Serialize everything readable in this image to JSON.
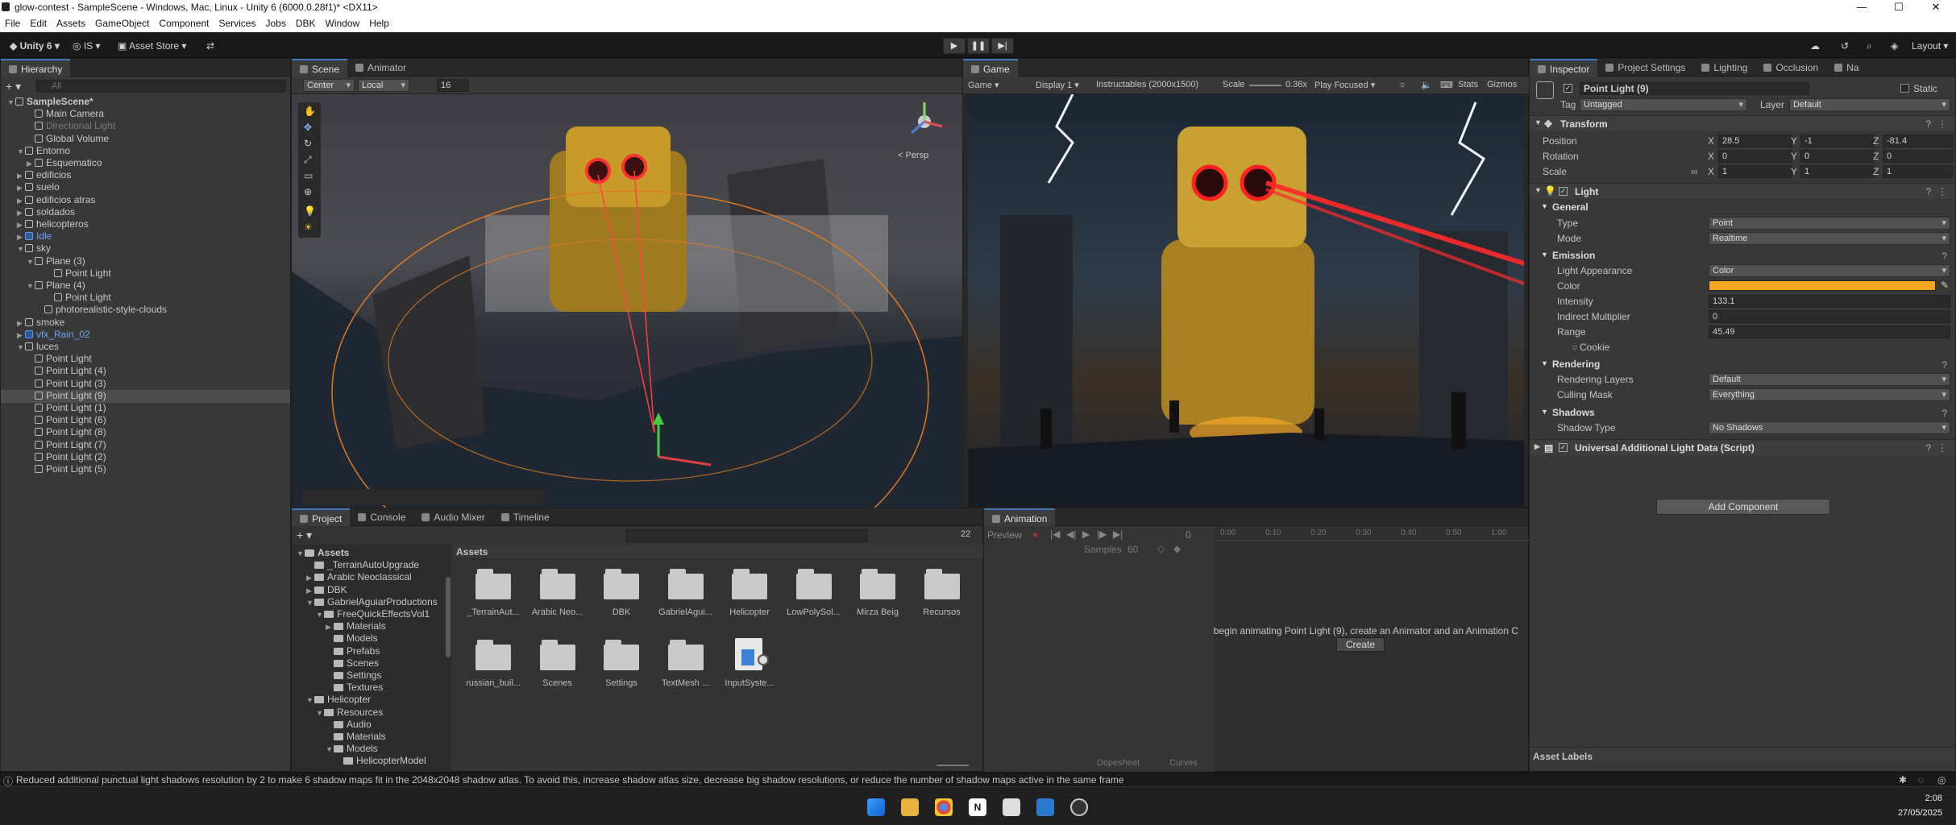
{
  "window": {
    "title": "glow-contest - SampleScene - Windows, Mac, Linux - Unity 6 (6000.0.28f1)* <DX11>",
    "minimize": "—",
    "maximize": "☐",
    "close": "✕"
  },
  "menu": [
    "File",
    "Edit",
    "Assets",
    "GameObject",
    "Component",
    "Services",
    "Jobs",
    "DBK",
    "Window",
    "Help"
  ],
  "toolbar": {
    "unity": "Unity 6",
    "account": "IS",
    "asset_store": "Asset Store",
    "layout": "Layout"
  },
  "hierarchy": {
    "tab": "Hierarchy",
    "search_placeholder": "All",
    "items": [
      {
        "label": "SampleScene*",
        "indent": 0,
        "arrow": "▼",
        "bold": true
      },
      {
        "label": "Main Camera",
        "indent": 2,
        "arrow": ""
      },
      {
        "label": "Directional Light",
        "indent": 2,
        "arrow": "",
        "dim": true
      },
      {
        "label": "Global Volume",
        "indent": 2,
        "arrow": ""
      },
      {
        "label": "Entorno",
        "indent": 1,
        "arrow": "▼"
      },
      {
        "label": "Esquematico",
        "indent": 2,
        "arrow": "▶"
      },
      {
        "label": "edificios",
        "indent": 1,
        "arrow": "▶"
      },
      {
        "label": "suelo",
        "indent": 1,
        "arrow": "▶"
      },
      {
        "label": "edificios atras",
        "indent": 1,
        "arrow": "▶"
      },
      {
        "label": "soldados",
        "indent": 1,
        "arrow": "▶"
      },
      {
        "label": "helicopteros",
        "indent": 1,
        "arrow": "▶"
      },
      {
        "label": "Idle",
        "indent": 1,
        "arrow": "▶",
        "blue": true
      },
      {
        "label": "sky",
        "indent": 1,
        "arrow": "▼"
      },
      {
        "label": "Plane (3)",
        "indent": 2,
        "arrow": "▼"
      },
      {
        "label": "Point Light",
        "indent": 4,
        "arrow": ""
      },
      {
        "label": "Plane (4)",
        "indent": 2,
        "arrow": "▼"
      },
      {
        "label": "Point Light",
        "indent": 4,
        "arrow": ""
      },
      {
        "label": "photorealistic-style-clouds",
        "indent": 3,
        "arrow": ""
      },
      {
        "label": "smoke",
        "indent": 1,
        "arrow": "▶"
      },
      {
        "label": "vfx_Rain_02",
        "indent": 1,
        "arrow": "▶",
        "blue": true
      },
      {
        "label": "luces",
        "indent": 1,
        "arrow": "▼"
      },
      {
        "label": "Point Light",
        "indent": 2,
        "arrow": ""
      },
      {
        "label": "Point Light (4)",
        "indent": 2,
        "arrow": ""
      },
      {
        "label": "Point Light (3)",
        "indent": 2,
        "arrow": ""
      },
      {
        "label": "Point Light (9)",
        "indent": 2,
        "arrow": "",
        "selected": true
      },
      {
        "label": "Point Light (1)",
        "indent": 2,
        "arrow": ""
      },
      {
        "label": "Point Light (6)",
        "indent": 2,
        "arrow": ""
      },
      {
        "label": "Point Light (8)",
        "indent": 2,
        "arrow": ""
      },
      {
        "label": "Point Light (7)",
        "indent": 2,
        "arrow": ""
      },
      {
        "label": "Point Light (2)",
        "indent": 2,
        "arrow": ""
      },
      {
        "label": "Point Light (5)",
        "indent": 2,
        "arrow": ""
      }
    ]
  },
  "scene": {
    "tabs": [
      "Scene",
      "Animator"
    ],
    "pivot": "Center",
    "space": "Local",
    "grid_size": "16",
    "persp": "< Persp"
  },
  "game": {
    "tab": "Game",
    "mode": "Game",
    "display": "Display 1",
    "resolution": "Instructables (2000x1500)",
    "scale_label": "Scale",
    "scale_value": "0.36x",
    "play_mode": "Play Focused",
    "stats": "Stats",
    "gizmos": "Gizmos"
  },
  "inspector": {
    "tabs": [
      "Inspector",
      "Project Settings",
      "Lighting",
      "Occlusion",
      "Na"
    ],
    "object_name": "Point Light (9)",
    "static": "Static",
    "tag_label": "Tag",
    "tag": "Untagged",
    "layer_label": "Layer",
    "layer": "Default",
    "transform": {
      "title": "Transform",
      "position_label": "Position",
      "rotation_label": "Rotation",
      "scale_label": "Scale",
      "position": {
        "x": "28.5",
        "y": "-1",
        "z": "-81.4"
      },
      "rotation": {
        "x": "0",
        "y": "0",
        "z": "0"
      },
      "scale": {
        "x": "1",
        "y": "1",
        "z": "1"
      }
    },
    "light": {
      "title": "Light",
      "general": "General",
      "type_label": "Type",
      "type": "Point",
      "mode_label": "Mode",
      "mode": "Realtime",
      "emission": "Emission",
      "appearance_label": "Light Appearance",
      "appearance": "Color",
      "color_label": "Color",
      "color": "#f5a623",
      "intensity_label": "Intensity",
      "intensity": "133.1",
      "indirect_label": "Indirect Multiplier",
      "indirect": "0",
      "range_label": "Range",
      "range": "45.49",
      "cookie_label": "Cookie",
      "rendering": "Rendering",
      "layers_label": "Rendering Layers",
      "layers": "Default",
      "culling_label": "Culling Mask",
      "culling": "Everything",
      "shadows": "Shadows",
      "shadow_type_label": "Shadow Type",
      "shadow_type": "No Shadows"
    },
    "ual": "Universal Additional Light Data (Script)",
    "add_component": "Add Component",
    "asset_labels": "Asset Labels"
  },
  "project": {
    "tabs": [
      "Project",
      "Console",
      "Audio Mixer",
      "Timeline"
    ],
    "count": "22",
    "breadcrumb": "Assets",
    "tree": [
      {
        "label": "Assets",
        "indent": 0,
        "arrow": "▼",
        "bold": true
      },
      {
        "label": "_TerrainAutoUpgrade",
        "indent": 1,
        "arrow": ""
      },
      {
        "label": "Arabic Neoclassical",
        "indent": 1,
        "arrow": "▶"
      },
      {
        "label": "DBK",
        "indent": 1,
        "arrow": "▶"
      },
      {
        "label": "GabrielAguiarProductions",
        "indent": 1,
        "arrow": "▼"
      },
      {
        "label": "FreeQuickEffectsVol1",
        "indent": 2,
        "arrow": "▼"
      },
      {
        "label": "Materials",
        "indent": 3,
        "arrow": "▶"
      },
      {
        "label": "Models",
        "indent": 3,
        "arrow": ""
      },
      {
        "label": "Prefabs",
        "indent": 3,
        "arrow": ""
      },
      {
        "label": "Scenes",
        "indent": 3,
        "arrow": ""
      },
      {
        "label": "Settings",
        "indent": 3,
        "arrow": ""
      },
      {
        "label": "Textures",
        "indent": 3,
        "arrow": ""
      },
      {
        "label": "Helicopter",
        "indent": 1,
        "arrow": "▼"
      },
      {
        "label": "Resources",
        "indent": 2,
        "arrow": "▼"
      },
      {
        "label": "Audio",
        "indent": 3,
        "arrow": ""
      },
      {
        "label": "Materials",
        "indent": 3,
        "arrow": ""
      },
      {
        "label": "Models",
        "indent": 3,
        "arrow": "▼"
      },
      {
        "label": "HelicopterModel",
        "indent": 4,
        "arrow": ""
      }
    ],
    "assets_row1": [
      "_TerrainAut...",
      "Arabic Neo...",
      "DBK",
      "GabrielAgui...",
      "Helicopter",
      "LowPolySol...",
      "Mirza Beig",
      "Recursos"
    ],
    "assets_row2": [
      "russian_buil...",
      "Scenes",
      "Settings",
      "TextMesh ...",
      "InputSyste..."
    ]
  },
  "animation": {
    "tab": "Animation",
    "preview": "Preview",
    "frame": "0",
    "samples_label": "Samples",
    "samples": "60",
    "ticks": [
      "0:00",
      "0:10",
      "0:20",
      "0:30",
      "0:40",
      "0:50",
      "1:00"
    ],
    "message": "begin animating Point Light (9), create an Animator and an Animation C",
    "create": "Create",
    "dopesheet": "Dopesheet",
    "curves": "Curves"
  },
  "status": "Reduced additional punctual light shadows resolution by 2 to make 6 shadow maps fit in the 2048x2048 shadow atlas. To avoid this, increase shadow atlas size, decrease big shadow resolutions, or reduce the number of shadow maps active in the same frame",
  "taskbar": {
    "time": "2:08",
    "date": "27/05/2025"
  }
}
